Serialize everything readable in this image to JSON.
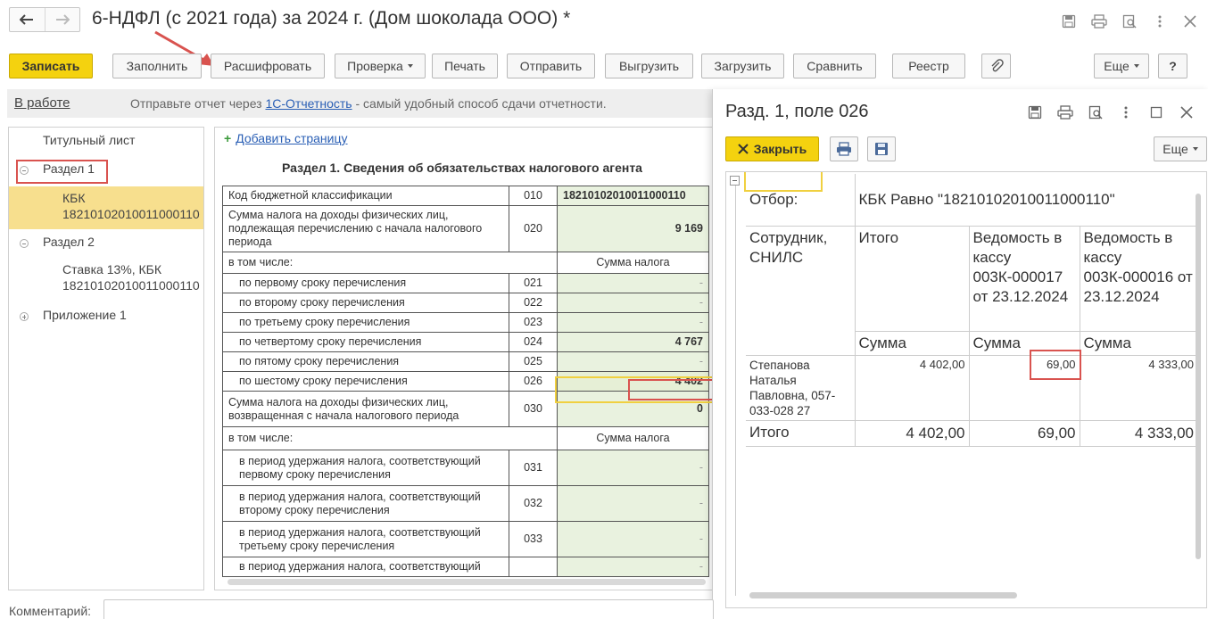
{
  "window": {
    "title": "6-НДФЛ (с 2021 года) за 2024 г. (Дом шоколада ООО) *"
  },
  "toolbar": {
    "save": "Записать",
    "fill": "Заполнить",
    "decode": "Расшифровать",
    "check": "Проверка",
    "print": "Печать",
    "send": "Отправить",
    "upload": "Выгрузить",
    "download": "Загрузить",
    "compare": "Сравнить",
    "registry": "Реестр",
    "more": "Еще",
    "help": "?"
  },
  "infobar": {
    "status": "В работе",
    "text_before": "Отправьте отчет через ",
    "link": "1С-Отчетность",
    "text_after": " - самый удобный способ сдачи отчетности."
  },
  "tree": {
    "title_page": "Титульный лист",
    "section1": "Раздел 1",
    "kbk_label": "КБК",
    "kbk_value": "18210102010011000110",
    "section2": "Раздел 2",
    "rate_line1": "Ставка 13%, КБК",
    "rate_line2": "18210102010011000110",
    "appendix": "Приложение 1"
  },
  "report": {
    "add_page": "Добавить страницу",
    "heading": "Раздел 1. Сведения об обязательствах налогового агента",
    "rows": [
      {
        "label": "Код бюджетной классификации",
        "code": "010",
        "value": "18210102010011000110"
      },
      {
        "label": "Сумма налога на доходы физических лиц, подлежащая перечислению с начала налогового периода",
        "code": "020",
        "value": "9 169"
      },
      {
        "label": "в том числе:",
        "header": "Сумма налога"
      },
      {
        "label": "по первому сроку перечисления",
        "code": "021",
        "value": "-"
      },
      {
        "label": "по второму сроку перечисления",
        "code": "022",
        "value": "-"
      },
      {
        "label": "по третьему сроку перечисления",
        "code": "023",
        "value": "-"
      },
      {
        "label": "по четвертому сроку перечисления",
        "code": "024",
        "value": "4 767"
      },
      {
        "label": "по пятому сроку перечисления",
        "code": "025",
        "value": "-"
      },
      {
        "label": "по шестому сроку перечисления",
        "code": "026",
        "value": "4 402"
      },
      {
        "label": "Сумма налога на доходы физических лиц, возвращенная с начала налогового периода",
        "code": "030",
        "value": "0"
      },
      {
        "label": "в том числе:",
        "header": "Сумма налога"
      },
      {
        "label": "в период удержания налога, соответствующий первому сроку перечисления",
        "code": "031",
        "value": "-"
      },
      {
        "label": "в период удержания налога, соответствующий второму сроку перечисления",
        "code": "032",
        "value": "-"
      },
      {
        "label": "в период удержания налога, соответствующий третьему сроку перечисления",
        "code": "033",
        "value": "-"
      },
      {
        "label": "в период удержания налога, соответствующий",
        "code": "",
        "value": "-"
      }
    ]
  },
  "popup": {
    "title": "Разд. 1, поле 026",
    "close": "Закрыть",
    "more": "Еще",
    "filter_label": "Отбор:",
    "filter_value": "КБК Равно \"18210102010011000110\"",
    "col_employee": "Сотрудник, СНИЛС",
    "col_total": "Итого",
    "col_sheet1": "Ведомость в кассу 003К-000017 от 23.12.2024",
    "col_sheet2": "Ведомость в кассу 003К-000016 от 23.12.2024",
    "sum_label": "Сумма",
    "employee": "Степанова Наталья Павловна, 057-033-028 27",
    "emp_total": "4 402,00",
    "emp_sheet1": "69,00",
    "emp_sheet2": "4 333,00",
    "total_label": "Итого",
    "total_total": "4 402,00",
    "total_sheet1": "69,00",
    "total_sheet2": "4 333,00"
  },
  "footer": {
    "comment_label": "Комментарий:"
  }
}
